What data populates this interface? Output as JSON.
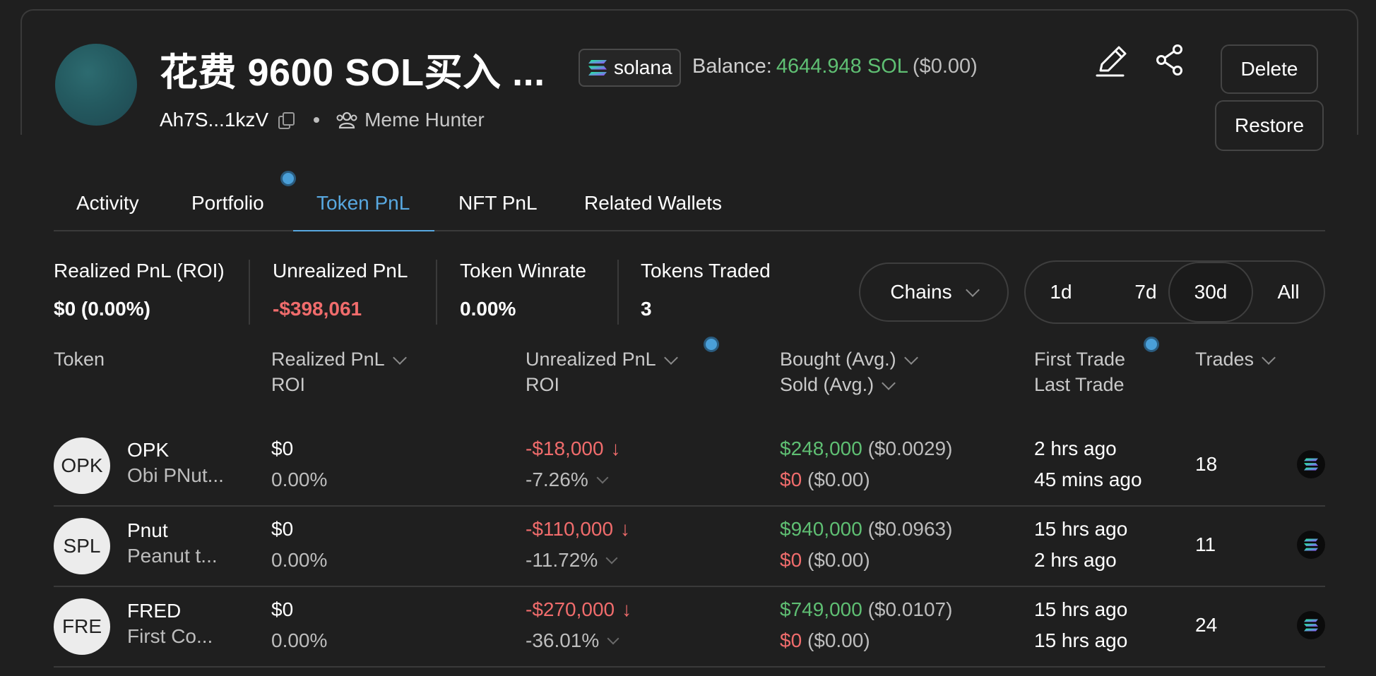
{
  "header": {
    "wallet_title": "花费 9600 SOL买入 ...",
    "chain_label": "solana",
    "balance_label": "Balance:",
    "balance_value": "4644.948 SOL",
    "balance_usd": "($0.00)",
    "address": "Ah7S...1kzV",
    "tag": "Meme Hunter",
    "delete_label": "Delete",
    "restore_label": "Restore"
  },
  "tabs": [
    {
      "label": "Activity"
    },
    {
      "label": "Portfolio"
    },
    {
      "label": "Token PnL",
      "active": true
    },
    {
      "label": "NFT PnL"
    },
    {
      "label": "Related Wallets"
    }
  ],
  "stats": {
    "realized": {
      "label": "Realized PnL (ROI)",
      "value": "$0 (0.00%)"
    },
    "unrealized": {
      "label": "Unrealized PnL",
      "value": "-$398,061"
    },
    "winrate": {
      "label": "Token Winrate",
      "value": "0.00%"
    },
    "traded": {
      "label": "Tokens Traded",
      "value": "3"
    }
  },
  "filters": {
    "chains_label": "Chains",
    "ranges": [
      "1d",
      "7d",
      "30d",
      "All"
    ],
    "selected_range": "30d"
  },
  "table": {
    "headers": {
      "token": "Token",
      "realized": "Realized PnL",
      "realized_sub": "ROI",
      "unrealized": "Unrealized PnL",
      "unrealized_sub": "ROI",
      "bought": "Bought (Avg.)",
      "sold": "Sold (Avg.)",
      "first_trade": "First Trade",
      "last_trade": "Last Trade",
      "trades": "Trades"
    },
    "rows": [
      {
        "avatar": "OPK",
        "symbol": "OPK",
        "name": "Obi PNut...",
        "realized": "$0",
        "realized_roi": "0.00%",
        "unrealized": "-$18,000",
        "unrealized_roi": "-7.26%",
        "bought": "$248,000",
        "bought_avg": "($0.0029)",
        "sold": "$0",
        "sold_avg": "($0.00)",
        "first_trade": "2 hrs ago",
        "last_trade": "45 mins ago",
        "trades": "18"
      },
      {
        "avatar": "SPL",
        "symbol": "Pnut",
        "name": "Peanut t...",
        "realized": "$0",
        "realized_roi": "0.00%",
        "unrealized": "-$110,000",
        "unrealized_roi": "-11.72%",
        "bought": "$940,000",
        "bought_avg": "($0.0963)",
        "sold": "$0",
        "sold_avg": "($0.00)",
        "first_trade": "15 hrs ago",
        "last_trade": "2 hrs ago",
        "trades": "11"
      },
      {
        "avatar": "FRE",
        "symbol": "FRED",
        "name": "First Co...",
        "realized": "$0",
        "realized_roi": "0.00%",
        "unrealized": "-$270,000",
        "unrealized_roi": "-36.01%",
        "bought": "$749,000",
        "bought_avg": "($0.0107)",
        "sold": "$0",
        "sold_avg": "($0.00)",
        "first_trade": "15 hrs ago",
        "last_trade": "15 hrs ago",
        "trades": "24"
      }
    ]
  },
  "colors": {
    "positive": "#5fbf73",
    "negative": "#f06c6c",
    "accent": "#58a8e0",
    "background": "#1f1f1f"
  }
}
